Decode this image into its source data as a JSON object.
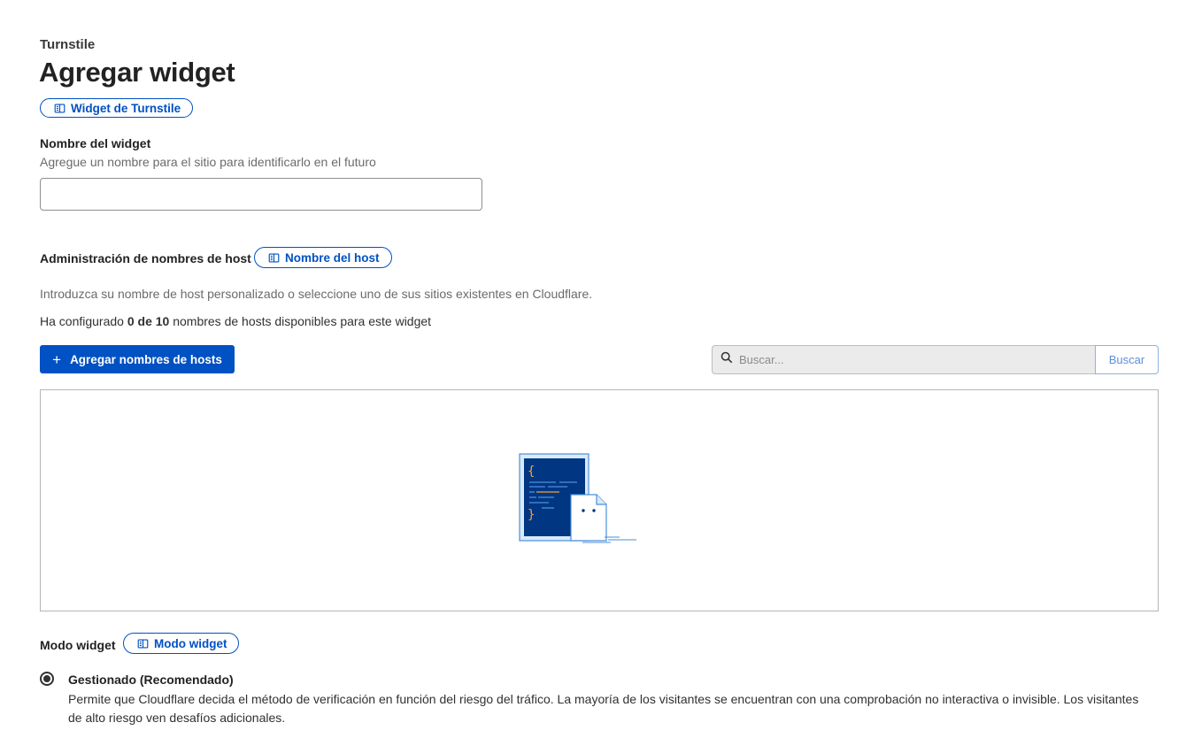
{
  "header": {
    "breadcrumb": "Turnstile",
    "title": "Agregar widget",
    "doc_link": "Widget de Turnstile"
  },
  "widget_name": {
    "label": "Nombre del widget",
    "description": "Agregue un nombre para el sitio para identificarlo en el futuro",
    "value": ""
  },
  "hostnames": {
    "label": "Administración de nombres de host",
    "doc_link": "Nombre del host",
    "description": "Introduzca su nombre de host personalizado o seleccione uno de sus sitios existentes en Cloudflare.",
    "count_prefix": "Ha configurado ",
    "count_value": "0 de 10",
    "count_suffix": " nombres de hosts disponibles para este widget",
    "add_button": "Agregar nombres de hosts",
    "search_placeholder": "Buscar...",
    "search_button": "Buscar"
  },
  "mode": {
    "label": "Modo widget",
    "doc_link": "Modo widget",
    "options": [
      {
        "title": "Gestionado (Recomendado)",
        "description": "Permite que Cloudflare decida el método de verificación en función del riesgo del tráfico. La mayoría de los visitantes se encuentran con una comprobación no interactiva o invisible. Los visitantes de alto riesgo ven desafíos adicionales.",
        "selected": true
      }
    ]
  },
  "colors": {
    "accent": "#0051c3",
    "illustration_dark": "#003682",
    "illustration_light": "#d9eafb"
  }
}
